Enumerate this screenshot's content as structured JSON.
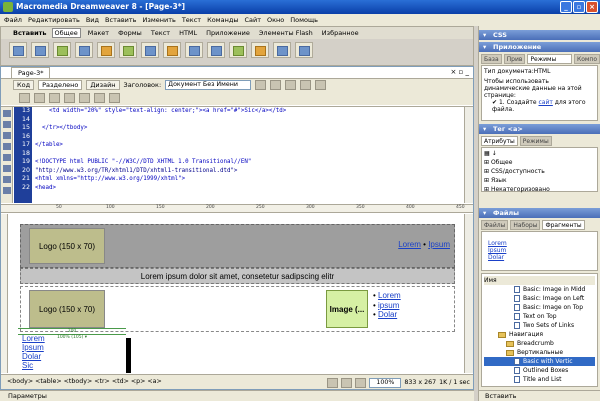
{
  "window": {
    "title": "Macromedia Dreamweaver 8 - [Page-3*]"
  },
  "menu": [
    "Файл",
    "Редактировать",
    "Вид",
    "Вставить",
    "Изменить",
    "Текст",
    "Команды",
    "Сайт",
    "Окно",
    "Помощь"
  ],
  "insert_bar": {
    "title": "Вставить",
    "tabs": [
      "Общее",
      "Макет",
      "Формы",
      "Текст",
      "HTML",
      "Приложение",
      "Элементы Flash",
      "Избранное"
    ],
    "active_tab": "Общее"
  },
  "document": {
    "tab": "Page-3*",
    "views": {
      "code": "Код",
      "split": "Разделено",
      "design": "Дизайн"
    },
    "title_label": "Заголовок:",
    "title_value": "Документ Без Имени"
  },
  "code": {
    "line_numbers": [
      "13",
      "14",
      "15",
      "16",
      "17",
      "18",
      "19",
      "20",
      "21",
      "22"
    ],
    "lines": [
      "    <td width=\"20%\" style=\"text-align: center;\"><a href=\"#\">Sic</a></td>",
      "",
      "  </tr></tbody>",
      "",
      "</table>",
      "",
      "<!DOCTYPE html PUBLIC \"-//W3C//DTD XHTML 1.0 Transitional//EN\"",
      "\"http://www.w3.org/TR/xhtml1/DTD/xhtml1-transitional.dtd\">",
      "<html xmlns=\"http://www.w3.org/1999/xhtml\">",
      "<head>"
    ]
  },
  "ruler": [
    "50",
    "100",
    "150",
    "200",
    "250",
    "300",
    "350",
    "400",
    "450"
  ],
  "design": {
    "logo_label": "Logo (150 x 70)",
    "header_links": {
      "link1": "Lorem",
      "separator": "•",
      "link2": "Ipsum"
    },
    "lorem_text": "Lorem ipsum dolor sit amet, consetetur sadipscing elitr",
    "image_label": "Image (...",
    "vertical_links": [
      "Lorem",
      "ipsum",
      "Dolar"
    ],
    "width_top": "200",
    "width_bottom": "100% (105) ▾",
    "left_links": [
      "Lorem",
      "Ipsum",
      "Dolar",
      "Sic"
    ]
  },
  "statusbar": {
    "tags": "<body> <table> <tbody> <tr> <td> <p> <a>",
    "zoom": "100%",
    "size": "833 x 267",
    "info": "1K / 1 sec"
  },
  "properties_bar": "Параметры",
  "panels": {
    "css": "CSS",
    "app": {
      "title": "Приложение",
      "tabs": [
        "База",
        "Прив",
        "Режимы сервера",
        "Компо"
      ],
      "active_tab": "Режимы сервера",
      "doc_type_label": "Тип документа:HTML",
      "instructions": "Чтобы использовать динамические данные на этой странице:",
      "step1_prefix": "1.",
      "step1_text": "Создайте",
      "step1_link": "сайт",
      "step1_suffix": "для этого файла."
    },
    "tag": {
      "title": "Тег <a>",
      "tabs": [
        "Атрибуты",
        "Режимы"
      ],
      "active_tab": "Атрибуты",
      "categories": [
        "Общее",
        "CSS/доступность",
        "Язык",
        "Некатегоризовано"
      ]
    },
    "files": {
      "title": "Файлы",
      "tabs": [
        "Файлы",
        "Наборы",
        "Фрагменты"
      ],
      "active_tab": "Фрагменты",
      "preview_links": [
        "Lorem",
        "Ipsum",
        "Dolar"
      ],
      "column": "Имя",
      "tree": [
        {
          "type": "file",
          "label": "Basic: Image in Midd",
          "indent": 30
        },
        {
          "type": "file",
          "label": "Basic: Image on Left",
          "indent": 30
        },
        {
          "type": "file",
          "label": "Basic: Image on Top",
          "indent": 30
        },
        {
          "type": "file",
          "label": "Text on Top",
          "indent": 30
        },
        {
          "type": "file",
          "label": "Two Sets of Links",
          "indent": 30
        },
        {
          "type": "folder",
          "label": "Навигация",
          "indent": 14
        },
        {
          "type": "folder",
          "label": "Breadcrumb",
          "indent": 22
        },
        {
          "type": "folder",
          "label": "Вертикальные",
          "indent": 22
        },
        {
          "type": "file",
          "label": "Basic with Vertic",
          "indent": 30
        },
        {
          "type": "file",
          "label": "Outlined Boxes",
          "indent": 30
        },
        {
          "type": "file",
          "label": "Title and List",
          "indent": 30
        }
      ],
      "footer": "Вставить"
    }
  }
}
